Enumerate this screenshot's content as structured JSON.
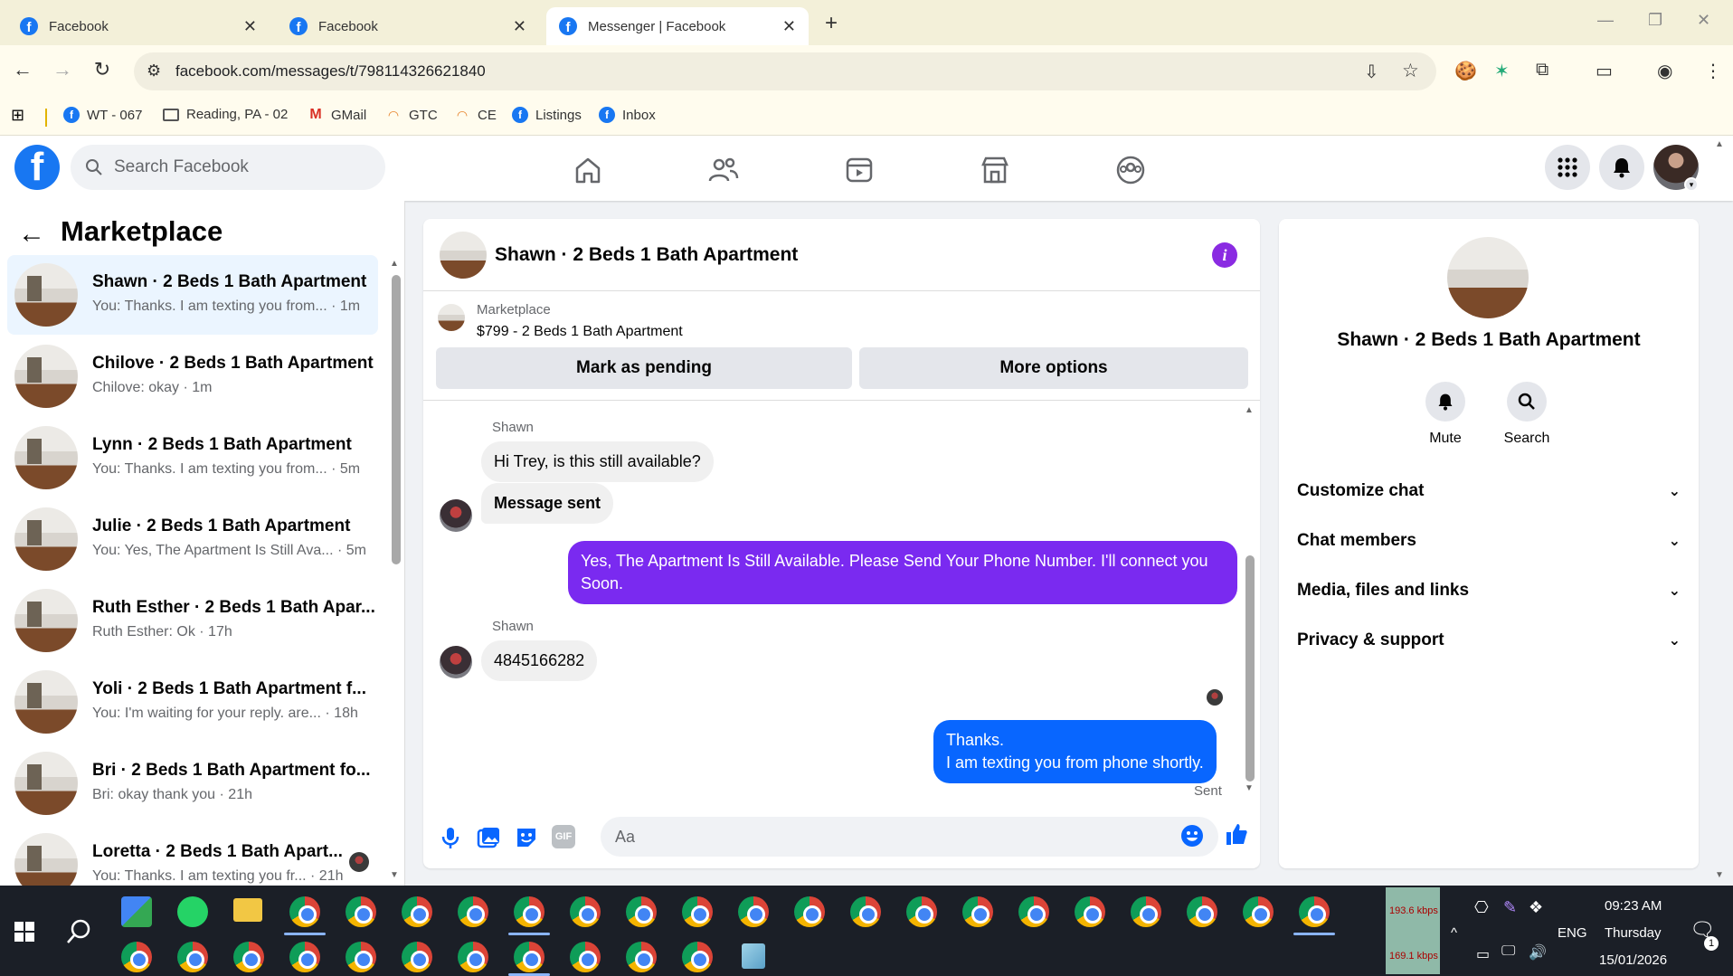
{
  "browser": {
    "tabs": [
      {
        "label": "Facebook",
        "active": false
      },
      {
        "label": "Facebook",
        "active": false
      },
      {
        "label": "Messenger | Facebook",
        "active": true
      }
    ],
    "url": "facebook.com/messages/t/798114326621840",
    "bookmarks": [
      {
        "label": "WT - 067",
        "icon": "facebook-icon"
      },
      {
        "label": "Reading, PA - 02",
        "icon": "folder-icon"
      },
      {
        "label": "GMail",
        "icon": "gmail-icon"
      },
      {
        "label": "GTC",
        "icon": "rainbow-icon"
      },
      {
        "label": "CE",
        "icon": "rainbow-icon"
      },
      {
        "label": "Listings",
        "icon": "facebook-icon"
      },
      {
        "label": "Inbox",
        "icon": "facebook-icon"
      }
    ]
  },
  "fb": {
    "search_placeholder": "Search Facebook"
  },
  "sidebar": {
    "title": "Marketplace",
    "conversations": [
      {
        "name": "Shawn · 2 Beds 1 Bath Apartment",
        "snippet": "You: Thanks. I am texting you from... · 1m",
        "selected": true
      },
      {
        "name": "Chilove · 2 Beds 1 Bath Apartment",
        "snippet": "Chilove: okay · 1m"
      },
      {
        "name": "Lynn · 2 Beds 1 Bath Apartment",
        "snippet": "You: Thanks. I am texting you from... · 5m"
      },
      {
        "name": "Julie · 2 Beds 1 Bath Apartment",
        "snippet": "You: Yes, The Apartment Is Still Ava... · 5m"
      },
      {
        "name": "Ruth Esther · 2 Beds 1 Bath Apar...",
        "snippet": "Ruth Esther: Ok · 17h"
      },
      {
        "name": "Yoli · 2 Beds 1 Bath Apartment f...",
        "snippet": "You: I'm waiting for your reply. are... · 18h"
      },
      {
        "name": "Bri · 2 Beds 1 Bath Apartment fo...",
        "snippet": "Bri: okay thank you · 21h"
      },
      {
        "name": "Loretta · 2 Beds 1 Bath Apart...",
        "snippet": "You: Thanks. I am texting you fr... · 21h"
      }
    ]
  },
  "chat": {
    "title": "Shawn · 2 Beds 1 Bath Apartment",
    "marketplace_label": "Marketplace",
    "listing": "$799 - 2 Beds 1 Bath Apartment",
    "mark_pending": "Mark as pending",
    "more_options": "More options",
    "sender1": "Shawn",
    "msg1": "Hi Trey, is this still available?",
    "msg2": "Message sent",
    "msg3": "Yes, The Apartment Is Still Available. Please Send Your Phone Number. I'll connect you Soon.",
    "sender2": "Shawn",
    "msg4": "4845166282",
    "msg5_line1": "Thanks.",
    "msg5_line2": "I am texting you from phone shortly.",
    "sent": "Sent",
    "input_placeholder": "Aa",
    "gif": "GIF"
  },
  "info_panel": {
    "name": "Shawn · 2 Beds 1 Bath Apartment",
    "mute": "Mute",
    "search": "Search",
    "sections": [
      "Customize chat",
      "Chat members",
      "Media, files and links",
      "Privacy & support"
    ]
  },
  "taskbar": {
    "net_up": "193.6 kbps",
    "net_down": "169.1 kbps",
    "lang": "ENG",
    "time": "09:23 AM",
    "day": "Thursday",
    "date": "15/01/2026",
    "notif_count": "1"
  },
  "colors": {
    "fb_blue": "#1877f2",
    "bubble_purple": "#7a2af0",
    "bubble_blue": "#0866ff"
  }
}
